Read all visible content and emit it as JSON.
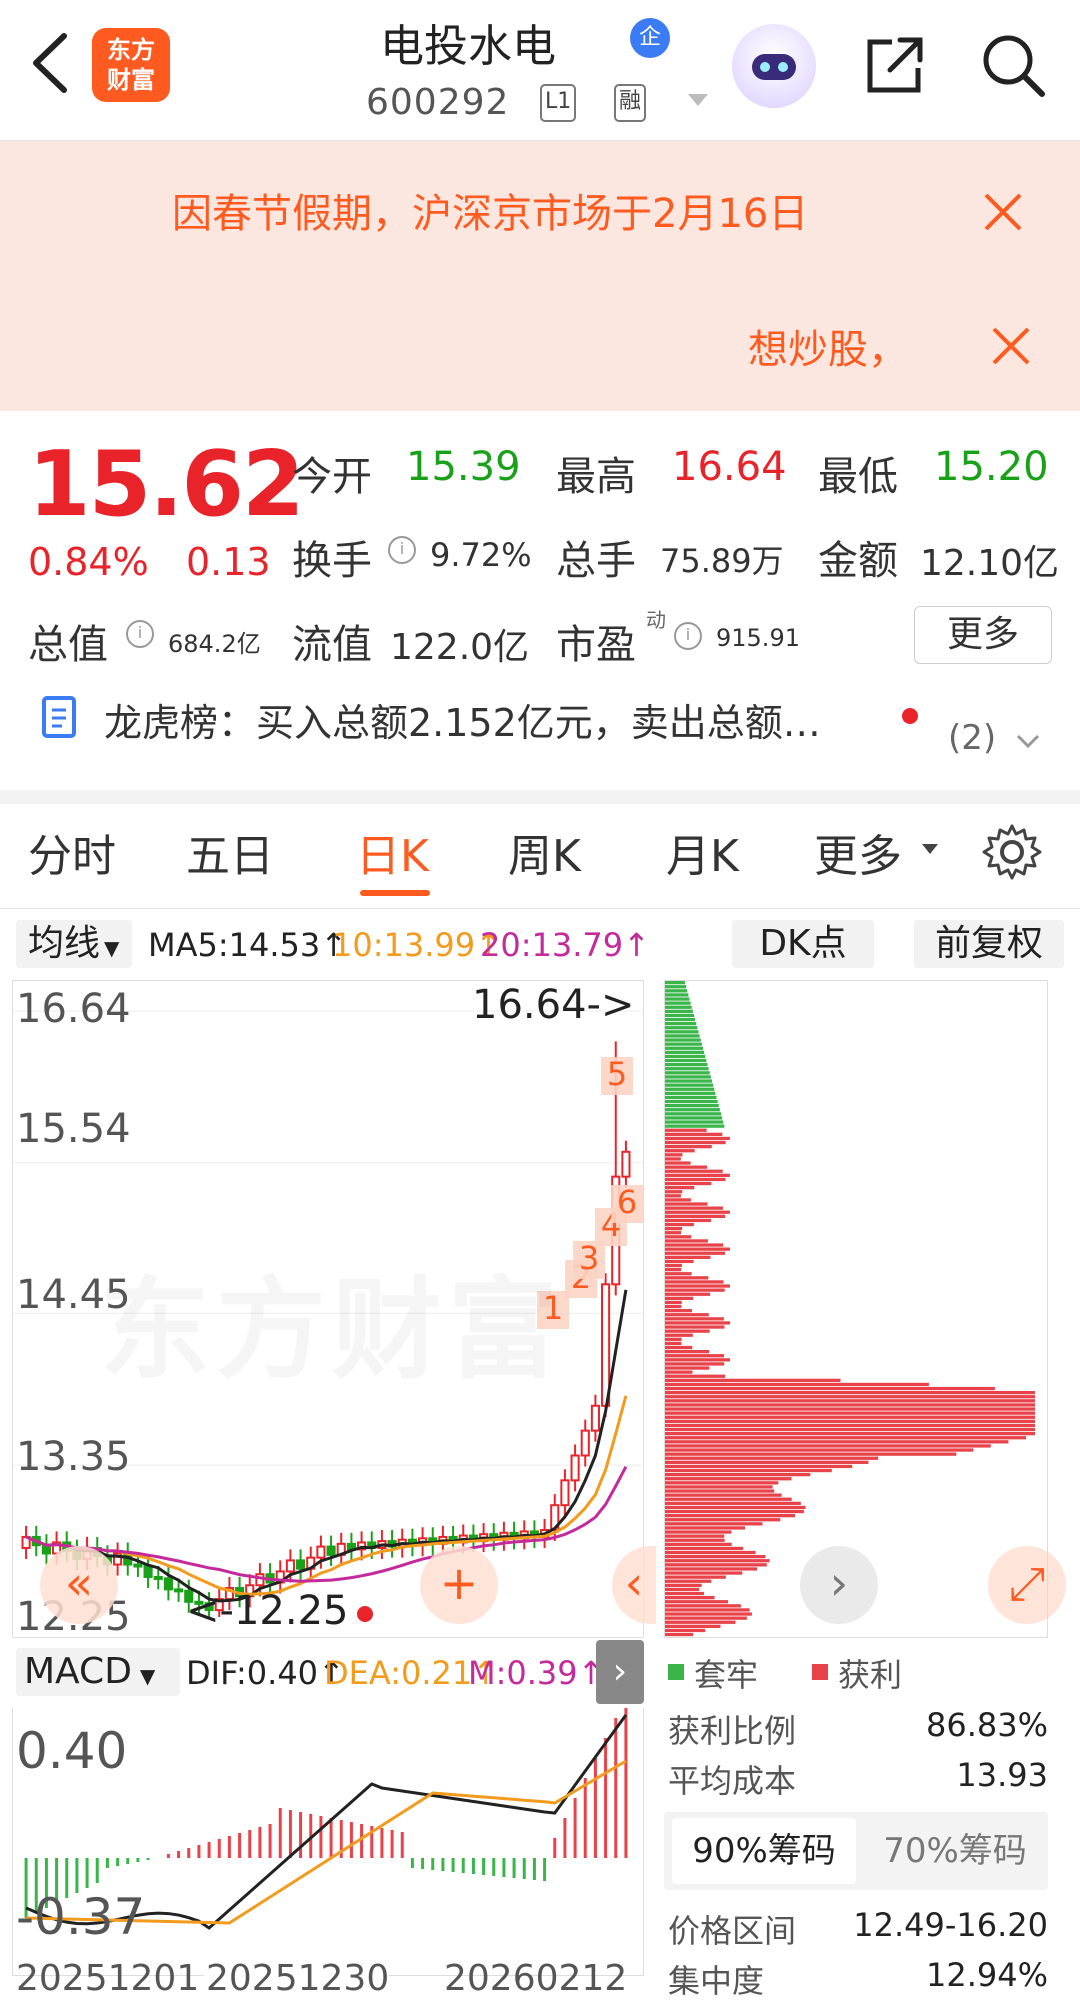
{
  "header": {
    "logo_text": "东方\n财富",
    "stock_name": "电投水电",
    "badge": "企",
    "stock_code": "600292",
    "tag_l1": "L1",
    "tag_rong": "融"
  },
  "notice": {
    "line1": "因春节假期，沪深京市场于2月16日",
    "line2": "想炒股，"
  },
  "quote": {
    "price": "15.62",
    "change_pct": "0.84%",
    "change_amt": "0.13",
    "open_label": "今开",
    "open": "15.39",
    "high_label": "最高",
    "high": "16.64",
    "low_label": "最低",
    "low": "15.20",
    "turnover_label": "换手",
    "turnover": "9.72%",
    "volume_label": "总手",
    "volume": "75.89万",
    "amount_label": "金额",
    "amount": "12.10亿",
    "mktcap_label": "总值",
    "mktcap": "684.2亿",
    "float_label": "流值",
    "float": "122.0亿",
    "pe_label": "市盈",
    "pe_sup": "动",
    "pe": "915.91",
    "more_button": "更多"
  },
  "lhb": {
    "text": "龙虎榜：买入总额2.152亿元，卖出总额…",
    "count": "(2)"
  },
  "tabs": [
    "分时",
    "五日",
    "日K",
    "周K",
    "月K",
    "更多"
  ],
  "active_tab": "日K",
  "ma_bar": {
    "select": "均线",
    "ma5": "MA5:14.53↑",
    "ma10": "10:13.99↑",
    "ma20": "20:13.79↑",
    "dk_button": "DK点",
    "fq_button": "前复权"
  },
  "kchart": {
    "y_labels": [
      "16.64",
      "15.54",
      "14.45",
      "13.35",
      "12.25"
    ],
    "high_marker": "16.64->",
    "low_marker": "<-12.25",
    "watermark": "东方财富",
    "signals": [
      "1",
      "2",
      "3",
      "4",
      "5",
      "6"
    ],
    "colors": {
      "up": "#e8232a",
      "down": "#1aa11a",
      "ma5": "#222222",
      "ma10": "#f29b1d",
      "ma20": "#c42a9b"
    }
  },
  "macd": {
    "select": "MACD",
    "dif": "DIF:0.40↑",
    "dea": "DEA:0.21↑",
    "m": "M:0.39↑",
    "top_label": "0.40",
    "bottom_label": "-0.37",
    "dates": [
      "20251201",
      "20251230",
      "20260212"
    ]
  },
  "chips": {
    "legend_trap": "套牢",
    "legend_profit": "获利",
    "profit_ratio_label": "获利比例",
    "profit_ratio": "86.83%",
    "avg_cost_label": "平均成本",
    "avg_cost": "13.93",
    "tab_90": "90%筹码",
    "tab_70": "70%筹码",
    "range_label": "价格区间",
    "range": "12.49-16.20",
    "concentration_label": "集中度",
    "concentration": "12.94%"
  }
}
